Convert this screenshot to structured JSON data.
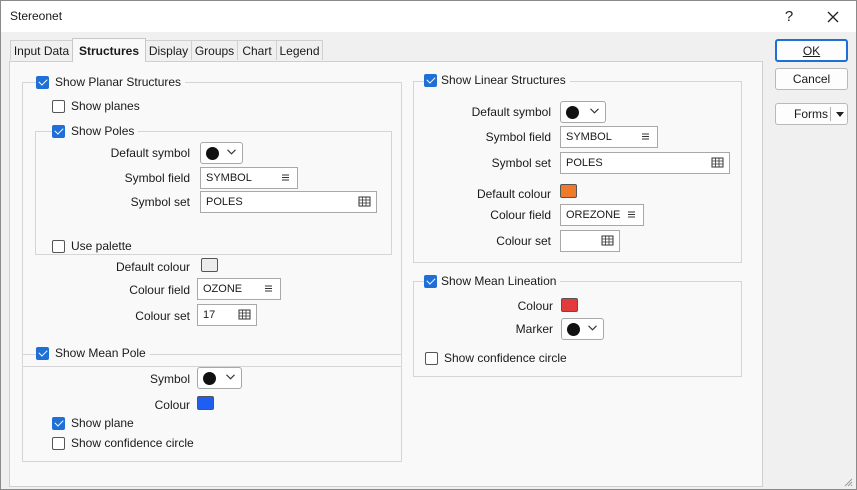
{
  "window": {
    "title": "Stereonet",
    "help_label": "?",
    "close_label": "✕"
  },
  "tabs": [
    {
      "label": "Input Data",
      "active": false
    },
    {
      "label": "Structures",
      "active": true
    },
    {
      "label": "Display",
      "active": false
    },
    {
      "label": "Groups",
      "active": false
    },
    {
      "label": "Chart",
      "active": false
    },
    {
      "label": "Legend",
      "active": false
    }
  ],
  "planar": {
    "show_label": "Show Planar Structures",
    "show_checked": true,
    "show_planes_label": "Show planes",
    "show_planes_checked": false,
    "poles": {
      "show_label": "Show Poles",
      "show_checked": true,
      "default_symbol_label": "Default symbol",
      "symbol_field_label": "Symbol field",
      "symbol_field_value": "SYMBOL",
      "symbol_set_label": "Symbol set",
      "symbol_set_value": "POLES"
    },
    "use_palette_label": "Use palette",
    "use_palette_checked": false,
    "default_colour_label": "Default colour",
    "default_colour": "#ececec",
    "colour_field_label": "Colour field",
    "colour_field_value": "OZONE",
    "colour_set_label": "Colour set",
    "colour_set_value": "17"
  },
  "mean_pole": {
    "show_label": "Show Mean Pole",
    "show_checked": true,
    "symbol_label": "Symbol",
    "colour_label": "Colour",
    "colour": "#1f5ff0",
    "show_plane_label": "Show plane",
    "show_plane_checked": true,
    "confidence_label": "Show confidence circle",
    "confidence_checked": false
  },
  "linear": {
    "show_label": "Show Linear Structures",
    "show_checked": true,
    "default_symbol_label": "Default symbol",
    "symbol_field_label": "Symbol field",
    "symbol_field_value": "SYMBOL",
    "symbol_set_label": "Symbol set",
    "symbol_set_value": "POLES",
    "default_colour_label": "Default colour",
    "default_colour": "#ef7a2a",
    "colour_field_label": "Colour field",
    "colour_field_value": "OREZONE",
    "colour_set_label": "Colour set",
    "colour_set_value": ""
  },
  "mean_lineation": {
    "show_label": "Show Mean Lineation",
    "show_checked": true,
    "colour_label": "Colour",
    "colour": "#e23b3b",
    "marker_label": "Marker",
    "confidence_label": "Show confidence circle",
    "confidence_checked": false
  },
  "buttons": {
    "ok": "OK",
    "cancel": "Cancel",
    "forms": "Forms"
  }
}
